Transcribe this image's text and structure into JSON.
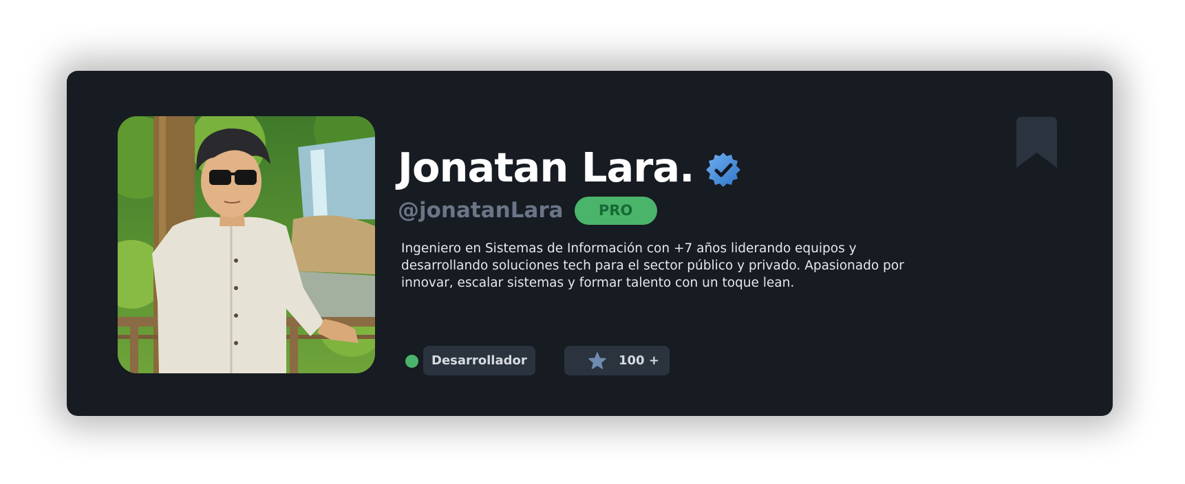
{
  "profile": {
    "name": "Jonatan Lara.",
    "handle": "@jonatanLara",
    "badge": "PRO",
    "bio": "Ingeniero en Sistemas de Información con +7 años liderando equipos y desarrollando soluciones tech para el sector público y privado. Apasionado por innovar, escalar sistemas y formar talento con un toque lean.",
    "role": "Desarrollador",
    "stars": "100 +",
    "status": "online"
  },
  "icons": {
    "verified": "verified-badge-icon",
    "star": "star-icon",
    "bookmark": "bookmark-icon"
  },
  "colors": {
    "card_background": "#171b22",
    "accent_green": "#4bb46b",
    "pro_text": "#156b34",
    "handle": "#6a7587",
    "chip_background": "#2b333f",
    "verified_blue": "#3d8be0",
    "star": "#6f8bb0",
    "bookmark": "#2b333f"
  }
}
